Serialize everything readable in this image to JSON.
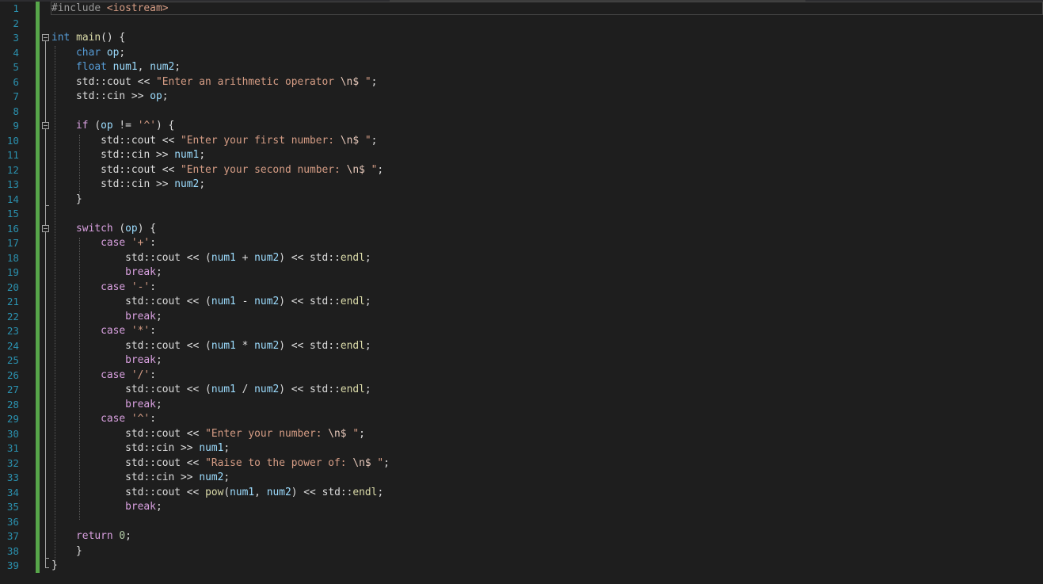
{
  "editor": {
    "line_numbers": [
      "1",
      "2",
      "3",
      "4",
      "5",
      "6",
      "7",
      "8",
      "9",
      "10",
      "11",
      "12",
      "13",
      "14",
      "15",
      "16",
      "17",
      "18",
      "19",
      "20",
      "21",
      "22",
      "23",
      "24",
      "25",
      "26",
      "27",
      "28",
      "29",
      "30",
      "31",
      "32",
      "33",
      "34",
      "35",
      "36",
      "37",
      "38",
      "39"
    ],
    "lines": [
      [
        {
          "t": "#include ",
          "c": "pp"
        },
        {
          "t": "<iostream>",
          "c": "inc"
        }
      ],
      [],
      [
        {
          "t": "int",
          "c": "kw"
        },
        {
          "t": " "
        },
        {
          "t": "main",
          "c": "fn"
        },
        {
          "t": "() {"
        }
      ],
      [
        {
          "t": "    "
        },
        {
          "t": "char",
          "c": "kw"
        },
        {
          "t": " "
        },
        {
          "t": "op",
          "c": "var"
        },
        {
          "t": ";"
        }
      ],
      [
        {
          "t": "    "
        },
        {
          "t": "float",
          "c": "kw"
        },
        {
          "t": " "
        },
        {
          "t": "num1",
          "c": "var"
        },
        {
          "t": ", "
        },
        {
          "t": "num2",
          "c": "var"
        },
        {
          "t": ";"
        }
      ],
      [
        {
          "t": "    "
        },
        {
          "t": "std",
          "c": "ns"
        },
        {
          "t": "::"
        },
        {
          "t": "cout",
          "c": "ns"
        },
        {
          "t": " << "
        },
        {
          "t": "\"Enter an arithmetic operator ",
          "c": "str"
        },
        {
          "t": "\\n$",
          "c": "esc"
        },
        {
          "t": " \"",
          "c": "str"
        },
        {
          "t": ";"
        }
      ],
      [
        {
          "t": "    "
        },
        {
          "t": "std",
          "c": "ns"
        },
        {
          "t": "::"
        },
        {
          "t": "cin",
          "c": "ns"
        },
        {
          "t": " >> "
        },
        {
          "t": "op",
          "c": "var"
        },
        {
          "t": ";"
        }
      ],
      [],
      [
        {
          "t": "    "
        },
        {
          "t": "if",
          "c": "ctl"
        },
        {
          "t": " ("
        },
        {
          "t": "op",
          "c": "var"
        },
        {
          "t": " != "
        },
        {
          "t": "'^'",
          "c": "str"
        },
        {
          "t": ") {"
        }
      ],
      [
        {
          "t": "        "
        },
        {
          "t": "std",
          "c": "ns"
        },
        {
          "t": "::"
        },
        {
          "t": "cout",
          "c": "ns"
        },
        {
          "t": " << "
        },
        {
          "t": "\"Enter your first number: ",
          "c": "str"
        },
        {
          "t": "\\n$",
          "c": "esc"
        },
        {
          "t": " \"",
          "c": "str"
        },
        {
          "t": ";"
        }
      ],
      [
        {
          "t": "        "
        },
        {
          "t": "std",
          "c": "ns"
        },
        {
          "t": "::"
        },
        {
          "t": "cin",
          "c": "ns"
        },
        {
          "t": " >> "
        },
        {
          "t": "num1",
          "c": "var"
        },
        {
          "t": ";"
        }
      ],
      [
        {
          "t": "        "
        },
        {
          "t": "std",
          "c": "ns"
        },
        {
          "t": "::"
        },
        {
          "t": "cout",
          "c": "ns"
        },
        {
          "t": " << "
        },
        {
          "t": "\"Enter your second number: ",
          "c": "str"
        },
        {
          "t": "\\n$",
          "c": "esc"
        },
        {
          "t": " \"",
          "c": "str"
        },
        {
          "t": ";"
        }
      ],
      [
        {
          "t": "        "
        },
        {
          "t": "std",
          "c": "ns"
        },
        {
          "t": "::"
        },
        {
          "t": "cin",
          "c": "ns"
        },
        {
          "t": " >> "
        },
        {
          "t": "num2",
          "c": "var"
        },
        {
          "t": ";"
        }
      ],
      [
        {
          "t": "    }"
        }
      ],
      [],
      [
        {
          "t": "    "
        },
        {
          "t": "switch",
          "c": "ctl"
        },
        {
          "t": " ("
        },
        {
          "t": "op",
          "c": "var"
        },
        {
          "t": ") {"
        }
      ],
      [
        {
          "t": "        "
        },
        {
          "t": "case",
          "c": "ctl"
        },
        {
          "t": " "
        },
        {
          "t": "'+'",
          "c": "str"
        },
        {
          "t": ":"
        }
      ],
      [
        {
          "t": "            "
        },
        {
          "t": "std",
          "c": "ns"
        },
        {
          "t": "::"
        },
        {
          "t": "cout",
          "c": "ns"
        },
        {
          "t": " << ("
        },
        {
          "t": "num1",
          "c": "var"
        },
        {
          "t": " + "
        },
        {
          "t": "num2",
          "c": "var"
        },
        {
          "t": ") << "
        },
        {
          "t": "std",
          "c": "ns"
        },
        {
          "t": "::"
        },
        {
          "t": "endl",
          "c": "fn"
        },
        {
          "t": ";"
        }
      ],
      [
        {
          "t": "            "
        },
        {
          "t": "break",
          "c": "ctl"
        },
        {
          "t": ";"
        }
      ],
      [
        {
          "t": "        "
        },
        {
          "t": "case",
          "c": "ctl"
        },
        {
          "t": " "
        },
        {
          "t": "'-'",
          "c": "str"
        },
        {
          "t": ":"
        }
      ],
      [
        {
          "t": "            "
        },
        {
          "t": "std",
          "c": "ns"
        },
        {
          "t": "::"
        },
        {
          "t": "cout",
          "c": "ns"
        },
        {
          "t": " << ("
        },
        {
          "t": "num1",
          "c": "var"
        },
        {
          "t": " - "
        },
        {
          "t": "num2",
          "c": "var"
        },
        {
          "t": ") << "
        },
        {
          "t": "std",
          "c": "ns"
        },
        {
          "t": "::"
        },
        {
          "t": "endl",
          "c": "fn"
        },
        {
          "t": ";"
        }
      ],
      [
        {
          "t": "            "
        },
        {
          "t": "break",
          "c": "ctl"
        },
        {
          "t": ";"
        }
      ],
      [
        {
          "t": "        "
        },
        {
          "t": "case",
          "c": "ctl"
        },
        {
          "t": " "
        },
        {
          "t": "'*'",
          "c": "str"
        },
        {
          "t": ":"
        }
      ],
      [
        {
          "t": "            "
        },
        {
          "t": "std",
          "c": "ns"
        },
        {
          "t": "::"
        },
        {
          "t": "cout",
          "c": "ns"
        },
        {
          "t": " << ("
        },
        {
          "t": "num1",
          "c": "var"
        },
        {
          "t": " * "
        },
        {
          "t": "num2",
          "c": "var"
        },
        {
          "t": ") << "
        },
        {
          "t": "std",
          "c": "ns"
        },
        {
          "t": "::"
        },
        {
          "t": "endl",
          "c": "fn"
        },
        {
          "t": ";"
        }
      ],
      [
        {
          "t": "            "
        },
        {
          "t": "break",
          "c": "ctl"
        },
        {
          "t": ";"
        }
      ],
      [
        {
          "t": "        "
        },
        {
          "t": "case",
          "c": "ctl"
        },
        {
          "t": " "
        },
        {
          "t": "'/'",
          "c": "str"
        },
        {
          "t": ":"
        }
      ],
      [
        {
          "t": "            "
        },
        {
          "t": "std",
          "c": "ns"
        },
        {
          "t": "::"
        },
        {
          "t": "cout",
          "c": "ns"
        },
        {
          "t": " << ("
        },
        {
          "t": "num1",
          "c": "var"
        },
        {
          "t": " / "
        },
        {
          "t": "num2",
          "c": "var"
        },
        {
          "t": ") << "
        },
        {
          "t": "std",
          "c": "ns"
        },
        {
          "t": "::"
        },
        {
          "t": "endl",
          "c": "fn"
        },
        {
          "t": ";"
        }
      ],
      [
        {
          "t": "            "
        },
        {
          "t": "break",
          "c": "ctl"
        },
        {
          "t": ";"
        }
      ],
      [
        {
          "t": "        "
        },
        {
          "t": "case",
          "c": "ctl"
        },
        {
          "t": " "
        },
        {
          "t": "'^'",
          "c": "str"
        },
        {
          "t": ":"
        }
      ],
      [
        {
          "t": "            "
        },
        {
          "t": "std",
          "c": "ns"
        },
        {
          "t": "::"
        },
        {
          "t": "cout",
          "c": "ns"
        },
        {
          "t": " << "
        },
        {
          "t": "\"Enter your number: ",
          "c": "str"
        },
        {
          "t": "\\n$",
          "c": "esc"
        },
        {
          "t": " \"",
          "c": "str"
        },
        {
          "t": ";"
        }
      ],
      [
        {
          "t": "            "
        },
        {
          "t": "std",
          "c": "ns"
        },
        {
          "t": "::"
        },
        {
          "t": "cin",
          "c": "ns"
        },
        {
          "t": " >> "
        },
        {
          "t": "num1",
          "c": "var"
        },
        {
          "t": ";"
        }
      ],
      [
        {
          "t": "            "
        },
        {
          "t": "std",
          "c": "ns"
        },
        {
          "t": "::"
        },
        {
          "t": "cout",
          "c": "ns"
        },
        {
          "t": " << "
        },
        {
          "t": "\"Raise to the power of: ",
          "c": "str"
        },
        {
          "t": "\\n$",
          "c": "esc"
        },
        {
          "t": " \"",
          "c": "str"
        },
        {
          "t": ";"
        }
      ],
      [
        {
          "t": "            "
        },
        {
          "t": "std",
          "c": "ns"
        },
        {
          "t": "::"
        },
        {
          "t": "cin",
          "c": "ns"
        },
        {
          "t": " >> "
        },
        {
          "t": "num2",
          "c": "var"
        },
        {
          "t": ";"
        }
      ],
      [
        {
          "t": "            "
        },
        {
          "t": "std",
          "c": "ns"
        },
        {
          "t": "::"
        },
        {
          "t": "cout",
          "c": "ns"
        },
        {
          "t": " << "
        },
        {
          "t": "pow",
          "c": "fn"
        },
        {
          "t": "("
        },
        {
          "t": "num1",
          "c": "var"
        },
        {
          "t": ", "
        },
        {
          "t": "num2",
          "c": "var"
        },
        {
          "t": ") << "
        },
        {
          "t": "std",
          "c": "ns"
        },
        {
          "t": "::"
        },
        {
          "t": "endl",
          "c": "fn"
        },
        {
          "t": ";"
        }
      ],
      [
        {
          "t": "            "
        },
        {
          "t": "break",
          "c": "ctl"
        },
        {
          "t": ";"
        }
      ],
      [],
      [
        {
          "t": "    "
        },
        {
          "t": "return",
          "c": "ctl"
        },
        {
          "t": " "
        },
        {
          "t": "0",
          "c": "num"
        },
        {
          "t": ";"
        }
      ],
      [
        {
          "t": "    }"
        }
      ],
      [
        {
          "t": "}"
        }
      ]
    ],
    "colors": {
      "background": "#1e1e1e",
      "line_number": "#2b91af",
      "change_bar": "#57a64a",
      "keyword": "#569cd6",
      "control": "#d8a0df",
      "string": "#d69d85",
      "variable": "#9cdcfe",
      "function": "#dcdcaa",
      "number": "#b5cea8"
    }
  }
}
